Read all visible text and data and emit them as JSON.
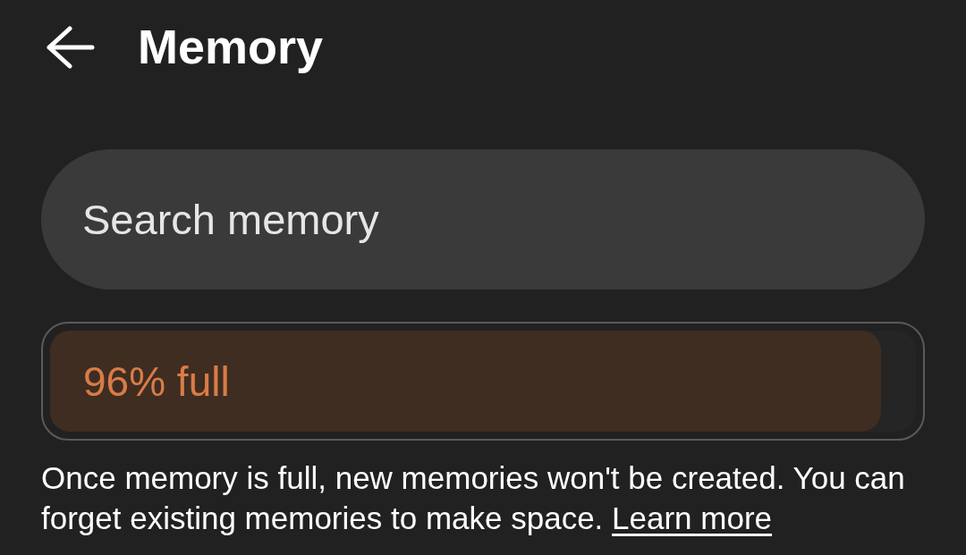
{
  "header": {
    "title": "Memory"
  },
  "search": {
    "placeholder": "Search memory"
  },
  "usage": {
    "label": "96% full",
    "level": 0.96
  },
  "note": {
    "text": "Once memory is full, new memories won't be created. You can forget existing memories to make space.",
    "link": "Learn more"
  }
}
